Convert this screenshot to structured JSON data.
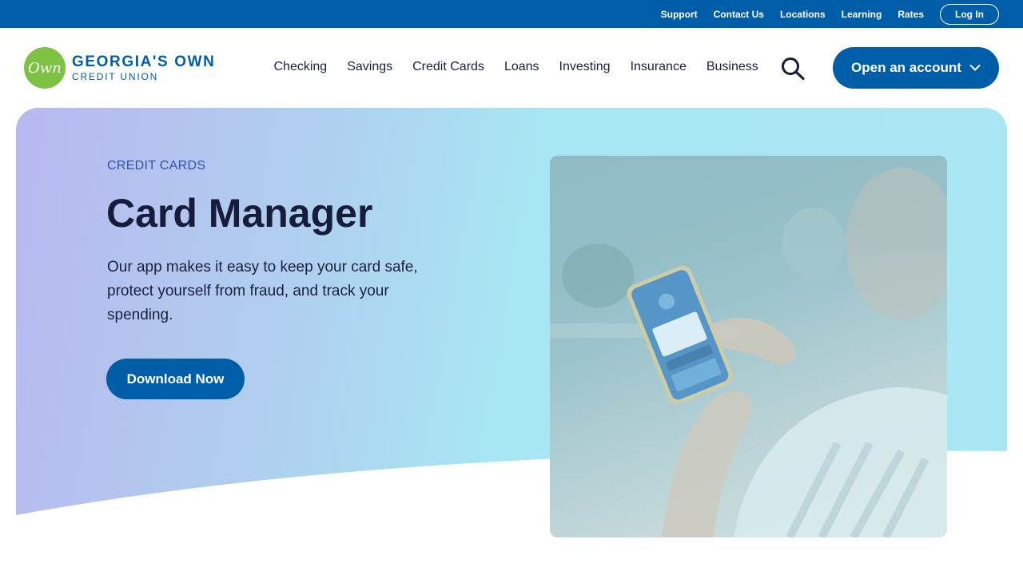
{
  "utility_nav": {
    "links": [
      "Support",
      "Contact Us",
      "Locations",
      "Learning",
      "Rates"
    ],
    "login_label": "Log In"
  },
  "brand": {
    "logo_mark": "Own",
    "name_line1": "GEORGIA'S OWN",
    "name_line2": "CREDIT UNION",
    "colors": {
      "primary": "#005ea8",
      "logo_green": "#7dc242"
    }
  },
  "main_nav": {
    "items": [
      "Checking",
      "Savings",
      "Credit Cards",
      "Loans",
      "Investing",
      "Insurance",
      "Business"
    ],
    "search_icon": "search-icon",
    "open_account_label": "Open an account"
  },
  "hero": {
    "eyebrow": "CREDIT CARDS",
    "title": "Card Manager",
    "description": "Our app makes it easy to keep your card safe, protect yourself from fraud, and track your spending.",
    "cta_label": "Download Now"
  }
}
